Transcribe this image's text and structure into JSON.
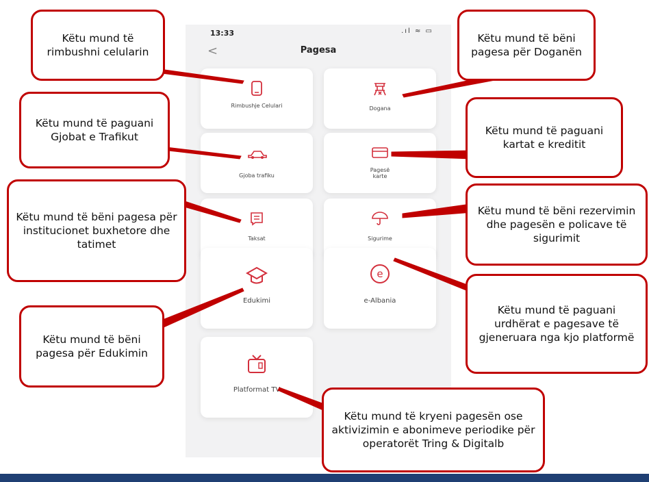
{
  "status": {
    "time": "13:33",
    "icons": ".ıl ≈ ▭"
  },
  "header": {
    "back": "<",
    "title": "Pagesa"
  },
  "tiles": [
    {
      "label": "Rimbushje Celulari",
      "icon": "phone-icon"
    },
    {
      "label": "Dogana",
      "icon": "customs-icon"
    },
    {
      "label": "Gjoba trafiku",
      "icon": "car-icon"
    },
    {
      "label": "Pagesë karte",
      "icon": "card-icon"
    },
    {
      "label": "Taksat",
      "icon": "receipt-icon"
    },
    {
      "label": "Sigurime",
      "icon": "umbrella-icon"
    },
    {
      "label": "Edukimi",
      "icon": "graduation-cap-icon"
    },
    {
      "label": "e-Albania",
      "icon": "e-circle-icon"
    },
    {
      "label": "Platformat TV",
      "icon": "tv-icon"
    }
  ],
  "callouts": {
    "celular": "Këtu mund të rimbushni celularin",
    "dogana": "Këtu mund të bëni pagesa për Doganën",
    "gjobat": "Këtu mund të paguani Gjobat e Trafikut",
    "kartat": "Këtu mund të paguani kartat e kreditit",
    "taksat": "Këtu mund të bëni pagesa për institucionet buxhetore dhe tatimet",
    "sigurime": "Këtu mund të bëni rezervimin dhe pagesën e policave të sigurimit",
    "edukimi": "Këtu mund të bëni pagesa për Edukimin",
    "ealbania": "Këtu mund të paguani urdhërat e pagesave të gjeneruara nga kjo platformë",
    "tv": "Këtu mund të kryeni pagesën ose aktivizimin e abonimeve periodike për operatorët Tring & Digitalb"
  },
  "colors": {
    "accent": "#d32f3c",
    "callout_border": "#c00000",
    "bar": "#1f3f73"
  }
}
